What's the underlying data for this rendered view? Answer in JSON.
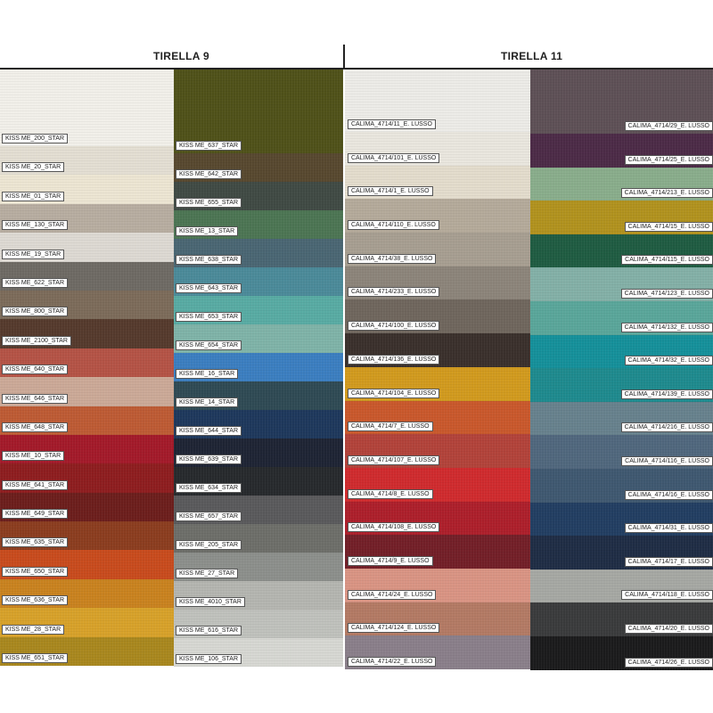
{
  "titles": {
    "left": "TIRELLA 9",
    "right": "TIRELLA 11"
  },
  "left_col_a": [
    {
      "label": "KISS ME_200_STAR",
      "color": "#f1efe9"
    },
    {
      "label": "KISS ME_20_STAR",
      "color": "#e3ded2"
    },
    {
      "label": "KISS ME_01_STAR",
      "color": "#ece5d2"
    },
    {
      "label": "KISS ME_130_STAR",
      "color": "#b7ada0"
    },
    {
      "label": "KISS ME_19_STAR",
      "color": "#ddd9d2"
    },
    {
      "label": "KISS ME_622_STAR",
      "color": "#6e6a64"
    },
    {
      "label": "KISS ME_800_STAR",
      "color": "#7c6b5a"
    },
    {
      "label": "KISS ME_2100_STAR",
      "color": "#553a2d"
    },
    {
      "label": "KISS ME_640_STAR",
      "color": "#b45346"
    },
    {
      "label": "KISS ME_646_STAR",
      "color": "#cba997"
    },
    {
      "label": "KISS ME_648_STAR",
      "color": "#bd5b34"
    },
    {
      "label": "KISS ME_10_STAR",
      "color": "#a31a2a"
    },
    {
      "label": "KISS ME_641_STAR",
      "color": "#8e1d1f"
    },
    {
      "label": "KISS ME_649_STAR",
      "color": "#6c1e1c"
    },
    {
      "label": "KISS ME_635_STAR",
      "color": "#8b3d1f"
    },
    {
      "label": "KISS ME_650_STAR",
      "color": "#c84b1d"
    },
    {
      "label": "KISS ME_636_STAR",
      "color": "#c9821f"
    },
    {
      "label": "KISS ME_28_STAR",
      "color": "#d7a12a"
    },
    {
      "label": "KISS ME_651_STAR",
      "color": "#a9871e"
    }
  ],
  "left_col_b": [
    {
      "label": "KISS ME_637_STAR",
      "color": "#4f5119"
    },
    {
      "label": "KISS ME_642_STAR",
      "color": "#57482f"
    },
    {
      "label": "KISS ME_655_STAR",
      "color": "#404a44"
    },
    {
      "label": "KISS ME_13_STAR",
      "color": "#4c7553"
    },
    {
      "label": "KISS ME_638_STAR",
      "color": "#4a6673"
    },
    {
      "label": "KISS ME_643_STAR",
      "color": "#4b8a99"
    },
    {
      "label": "KISS ME_653_STAR",
      "color": "#58aba3"
    },
    {
      "label": "KISS ME_654_STAR",
      "color": "#7fb3a8"
    },
    {
      "label": "KISS ME_16_STAR",
      "color": "#3b7ec0"
    },
    {
      "label": "KISS ME_14_STAR",
      "color": "#2f4a54"
    },
    {
      "label": "KISS ME_644_STAR",
      "color": "#1e385c"
    },
    {
      "label": "KISS ME_639_STAR",
      "color": "#1e2434"
    },
    {
      "label": "KISS ME_634_STAR",
      "color": "#272a2d"
    },
    {
      "label": "KISS ME_657_STAR",
      "color": "#5a5a5c"
    },
    {
      "label": "KISS ME_205_STAR",
      "color": "#6d6e69"
    },
    {
      "label": "KISS ME_27_STAR",
      "color": "#8c8f8b"
    },
    {
      "label": "KISS ME_4010_STAR",
      "color": "#b4b5b0"
    },
    {
      "label": "KISS ME_616_STAR",
      "color": "#bfc1bc"
    },
    {
      "label": "KISS ME_106_STAR",
      "color": "#d6d7d2"
    }
  ],
  "right_col_a": [
    {
      "label": "CALIMA_4714/11_E. LUSSO",
      "color": "#ecebe7"
    },
    {
      "label": "CALIMA_4714/101_E. LUSSO",
      "color": "#e9e6de"
    },
    {
      "label": "CALIMA_4714/1_E. LUSSO",
      "color": "#e3dccc"
    },
    {
      "label": "CALIMA_4714/110_E. LUSSO",
      "color": "#b4aa9a"
    },
    {
      "label": "CALIMA_4714/38_E. LUSSO",
      "color": "#a79e91"
    },
    {
      "label": "CALIMA_4714/233_E. LUSSO",
      "color": "#8c847a"
    },
    {
      "label": "CALIMA_4714/100_E. LUSSO",
      "color": "#6f665d"
    },
    {
      "label": "CALIMA_4714/136_E. LUSSO",
      "color": "#3a302c"
    },
    {
      "label": "CALIMA_4714/104_E. LUSSO",
      "color": "#d19a1e"
    },
    {
      "label": "CALIMA_4714/7_E. LUSSO",
      "color": "#c9582c"
    },
    {
      "label": "CALIMA_4714/107_E. LUSSO",
      "color": "#b2433a"
    },
    {
      "label": "CALIMA_4714/8_E. LUSSO",
      "color": "#cf2b2e"
    },
    {
      "label": "CALIMA_4714/108_E. LUSSO",
      "color": "#ad1f2b"
    },
    {
      "label": "CALIMA_4714/9_E. LUSSO",
      "color": "#731f28"
    },
    {
      "label": "CALIMA_4714/24_E. LUSSO",
      "color": "#d99483"
    },
    {
      "label": "CALIMA_4714/124_E. LUSSO",
      "color": "#b37a64"
    },
    {
      "label": "CALIMA_4714/22_E. LUSSO",
      "color": "#8a7f8a"
    }
  ],
  "right_col_b": [
    {
      "label": "CALIMA_4714/29_E. LUSSO",
      "color": "#5e5056"
    },
    {
      "label": "CALIMA_4714/25_E. LUSSO",
      "color": "#4c2b47"
    },
    {
      "label": "CALIMA_4714/213_E. LUSSO",
      "color": "#89ad8b"
    },
    {
      "label": "CALIMA_4714/15_E. LUSSO",
      "color": "#b1921e"
    },
    {
      "label": "CALIMA_4714/115_E. LUSSO",
      "color": "#1f5c42"
    },
    {
      "label": "CALIMA_4714/123_E. LUSSO",
      "color": "#83b0a7"
    },
    {
      "label": "CALIMA_4714/132_E. LUSSO",
      "color": "#5aa69a"
    },
    {
      "label": "CALIMA_4714/32_E. LUSSO",
      "color": "#15909a"
    },
    {
      "label": "CALIMA_4714/139_E. LUSSO",
      "color": "#1e8a8e"
    },
    {
      "label": "CALIMA_4714/216_E. LUSSO",
      "color": "#67818d"
    },
    {
      "label": "CALIMA_4714/116_E. LUSSO",
      "color": "#50677d"
    },
    {
      "label": "CALIMA_4714/16_E. LUSSO",
      "color": "#3f5870"
    },
    {
      "label": "CALIMA_4714/31_E. LUSSO",
      "color": "#223e62"
    },
    {
      "label": "CALIMA_4714/17_E. LUSSO",
      "color": "#1f2d45"
    },
    {
      "label": "CALIMA_4714/118_E. LUSSO",
      "color": "#a6a8a3"
    },
    {
      "label": "CALIMA_4714/20_E. LUSSO",
      "color": "#3a3b3c"
    },
    {
      "label": "CALIMA_4714/26_E. LUSSO",
      "color": "#1b1b1c"
    }
  ]
}
